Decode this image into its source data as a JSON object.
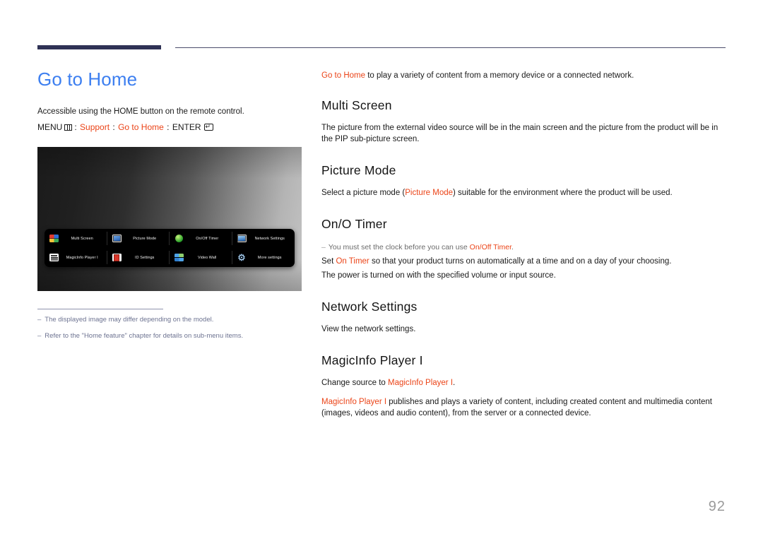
{
  "page": {
    "title": "Go to Home",
    "number": "92",
    "title_color": "#3d7ff0",
    "accent_color": "#eb4418",
    "rule_color": "#2f3255"
  },
  "left": {
    "intro": "Accessible using the HOME button on the remote control.",
    "menu_path": {
      "menu_label": "MENU",
      "menu_icon": "menu-grid-icon",
      "sep": ":",
      "step1": "Support",
      "step2": "Go to Home",
      "enter_label": "ENTER",
      "enter_icon": "enter-key-icon"
    },
    "figure": {
      "alt": "home-menu-screenshot",
      "menu_items": [
        {
          "icon": "multi-screen-icon",
          "label": "Multi Screen"
        },
        {
          "icon": "picture-mode-icon",
          "label": "Picture Mode"
        },
        {
          "icon": "on-off-timer-icon",
          "label": "On/Off Timer"
        },
        {
          "icon": "network-settings-icon",
          "label": "Network Settings"
        },
        {
          "icon": "magicinfo-player-icon",
          "label": "MagicInfo Player I"
        },
        {
          "icon": "id-settings-icon",
          "label": "ID Settings"
        },
        {
          "icon": "video-wall-icon",
          "label": "Video Wall"
        },
        {
          "icon": "more-settings-icon",
          "label": "More settings"
        }
      ]
    },
    "footnotes": [
      {
        "dash": "–",
        "text": "The displayed image may differ depending on the model."
      },
      {
        "dash": "–",
        "text": "Refer to the \"Home feature\" chapter for details on sub-menu items."
      }
    ]
  },
  "right": {
    "intro": {
      "highlight": "Go to Home",
      "rest": " to play a variety of content from a memory device or a connected network."
    },
    "sections": [
      {
        "heading": "Multi Screen",
        "body": "The picture from the external video source will be in the main screen and the picture from the product will be in the PIP sub-picture screen."
      },
      {
        "heading": "Picture Mode",
        "body_pre": "Select a picture mode (",
        "body_hl": "Picture Mode",
        "body_post": ") suitable for the environment where the product will be used."
      },
      {
        "heading": "On/O Timer",
        "note_dash": "–",
        "note_pre": "You must set the clock before you can use ",
        "note_hl": "On/Off Timer",
        "note_post": ".",
        "body1_pre": "Set ",
        "body1_hl": "On Timer",
        "body1_post": " so that your product turns on automatically at a time and on a day of your choosing.",
        "body2": "The power is turned on with the specified volume or input source."
      },
      {
        "heading": "Network Settings",
        "body": "View the network settings."
      },
      {
        "heading": "MagicInfo Player I",
        "body1_pre": "Change source to ",
        "body1_hl": "MagicInfo Player I",
        "body1_post": ".",
        "body2_hl": "MagicInfo Player I",
        "body2_post": " publishes and plays a variety of content, including created content and multimedia content (images, videos and audio content), from the server or a connected device."
      }
    ]
  }
}
